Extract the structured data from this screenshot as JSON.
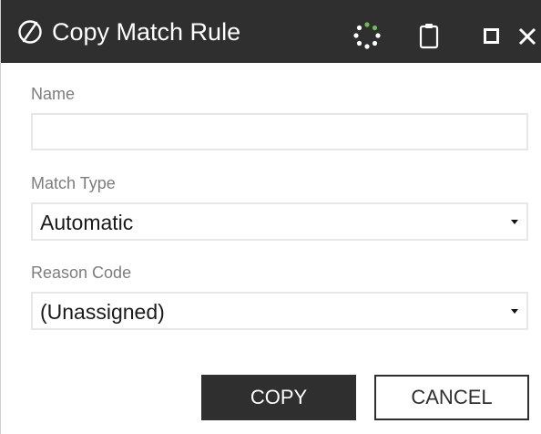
{
  "window": {
    "title": "Copy Match Rule"
  },
  "icons": {
    "logo": "slashed-circle-logo-icon",
    "spinner": "loading-spinner-icon",
    "clipboard": "clipboard-icon",
    "maximize": "maximize-icon",
    "close": "close-icon"
  },
  "colors": {
    "titlebar": "#2f2f2f",
    "spinner_accent": "#6cc04a",
    "primary_button": "#2f2f2f"
  },
  "form": {
    "name": {
      "label": "Name",
      "value": ""
    },
    "match_type": {
      "label": "Match Type",
      "value": "Automatic"
    },
    "reason_code": {
      "label": "Reason Code",
      "value": "(Unassigned)"
    }
  },
  "buttons": {
    "copy": "COPY",
    "cancel": "CANCEL"
  }
}
